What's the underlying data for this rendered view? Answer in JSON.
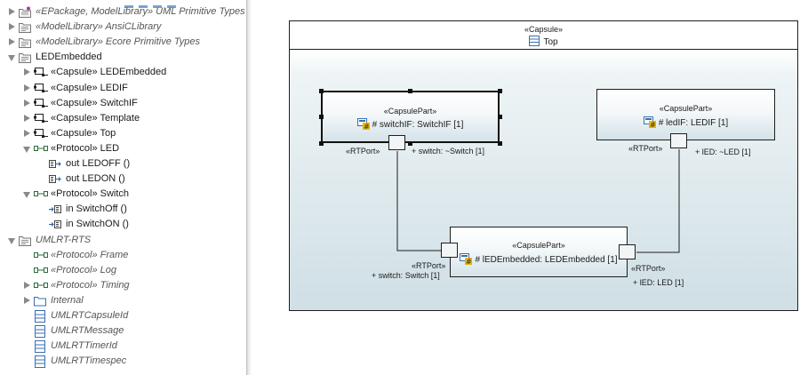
{
  "tree": {
    "items": [
      {
        "label": "«EPackage, ModelLibrary» UML Primitive Types",
        "italic": true,
        "icon": "epackage-library-icon",
        "toggle": "collapsed",
        "indent": 0
      },
      {
        "label": "«ModelLibrary» AnsiCLibrary",
        "italic": true,
        "icon": "model-library-icon",
        "toggle": "collapsed",
        "indent": 0
      },
      {
        "label": "«ModelLibrary» Ecore Primitive Types",
        "italic": true,
        "icon": "model-library-icon",
        "toggle": "collapsed",
        "indent": 0
      },
      {
        "label": "LEDEmbedded",
        "italic": false,
        "icon": "model-library-icon",
        "toggle": "expanded",
        "indent": 0
      },
      {
        "label": "«Capsule» LEDEmbedded",
        "italic": false,
        "icon": "capsule-icon",
        "toggle": "collapsed",
        "indent": 1
      },
      {
        "label": "«Capsule» LEDIF",
        "italic": false,
        "icon": "capsule-icon",
        "toggle": "collapsed",
        "indent": 1
      },
      {
        "label": "«Capsule» SwitchIF",
        "italic": false,
        "icon": "capsule-icon",
        "toggle": "collapsed",
        "indent": 1
      },
      {
        "label": "«Capsule» Template",
        "italic": false,
        "icon": "capsule-icon",
        "toggle": "collapsed",
        "indent": 1
      },
      {
        "label": "«Capsule» Top",
        "italic": false,
        "icon": "capsule-icon",
        "toggle": "collapsed",
        "indent": 1
      },
      {
        "label": "«Protocol» LED",
        "italic": false,
        "icon": "protocol-icon",
        "toggle": "expanded",
        "indent": 1
      },
      {
        "label": "out LEDOFF ()",
        "italic": false,
        "icon": "out-event-icon",
        "toggle": "none",
        "indent": 2
      },
      {
        "label": "out LEDON ()",
        "italic": false,
        "icon": "out-event-icon",
        "toggle": "none",
        "indent": 2
      },
      {
        "label": "«Protocol» Switch",
        "italic": false,
        "icon": "protocol-icon",
        "toggle": "expanded",
        "indent": 1
      },
      {
        "label": "in SwitchOff ()",
        "italic": false,
        "icon": "in-event-icon",
        "toggle": "none",
        "indent": 2
      },
      {
        "label": "in SwitchON ()",
        "italic": false,
        "icon": "in-event-icon",
        "toggle": "none",
        "indent": 2
      },
      {
        "label": "UMLRT-RTS",
        "italic": true,
        "icon": "model-library-icon",
        "toggle": "expanded",
        "indent": 0
      },
      {
        "label": "«Protocol» Frame",
        "italic": true,
        "icon": "protocol-icon",
        "toggle": "none",
        "indent": 1
      },
      {
        "label": "«Protocol» Log",
        "italic": true,
        "icon": "protocol-icon",
        "toggle": "none",
        "indent": 1
      },
      {
        "label": "«Protocol» Timing",
        "italic": true,
        "icon": "protocol-icon",
        "toggle": "collapsed",
        "indent": 1
      },
      {
        "label": "Internal",
        "italic": true,
        "icon": "folder-icon",
        "toggle": "collapsed",
        "indent": 1
      },
      {
        "label": "UMLRTCapsuleId",
        "italic": true,
        "icon": "class-icon",
        "toggle": "none",
        "indent": 1
      },
      {
        "label": "UMLRTMessage",
        "italic": true,
        "icon": "class-icon",
        "toggle": "none",
        "indent": 1
      },
      {
        "label": "UMLRTTimerId",
        "italic": true,
        "icon": "class-icon",
        "toggle": "none",
        "indent": 1
      },
      {
        "label": "UMLRTTimespec",
        "italic": true,
        "icon": "class-icon",
        "toggle": "none",
        "indent": 1
      }
    ]
  },
  "diagram": {
    "capsule": {
      "stereotype": "«Capsule»",
      "name": "Top"
    },
    "parts": {
      "switchif": {
        "stereotype": "«CapsulePart»",
        "name": "# switchIF: SwitchIF [1]"
      },
      "ledif": {
        "stereotype": "«CapsulePart»",
        "name": "# ledIF: LEDIF [1]"
      },
      "ledembedded": {
        "stereotype": "«CapsulePart»",
        "name": "# lEDEmbedded: LEDEmbedded [1]"
      }
    },
    "ports": {
      "switchif_port": {
        "stereotype": "«RTPort»",
        "name": "+ switch: ~Switch [1]"
      },
      "ledif_port": {
        "stereotype": "«RTPort»",
        "name": "+ lED: ~LED [1]"
      },
      "emb_switch_port": {
        "stereotype": "«RTPort»",
        "name": "+ switch: Switch [1]"
      },
      "emb_led_port": {
        "stereotype": "«RTPort»",
        "name": "+ lED: LED [1]"
      }
    }
  },
  "colors": {
    "frame": "#1e1e1e",
    "selection": "#111111",
    "part_gradient_end": "#d3e2e8",
    "icon_blue": "#3a6fb0",
    "icon_yellow": "#e8b400"
  }
}
